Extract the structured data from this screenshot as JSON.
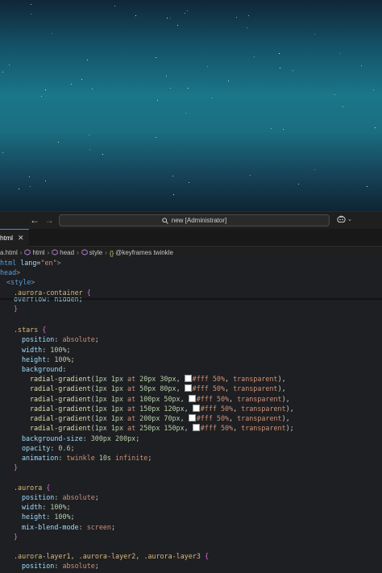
{
  "titlebar": {
    "search_text": "new [Administrator]"
  },
  "tab": {
    "label": "html",
    "close": "✕"
  },
  "breadcrumb": {
    "items": [
      "a.html",
      "html",
      "head",
      "style",
      "@keyframes twinkle"
    ]
  },
  "editor": {
    "lines": [
      {
        "kind": "html-open",
        "tag": "html",
        "attr": "lang",
        "val": "\"en\""
      },
      {
        "kind": "html-tag",
        "tag": "head"
      },
      {
        "kind": "html-tag",
        "tag": "style"
      },
      {
        "kind": "selector-open",
        "text": ".aurora-container"
      },
      {
        "kind": "partial",
        "text": "overflow: hidden;"
      },
      {
        "kind": "close"
      },
      {
        "kind": "blank"
      },
      {
        "kind": "selector-open",
        "text": ".stars"
      },
      {
        "kind": "decl",
        "prop": "position",
        "val": "absolute"
      },
      {
        "kind": "decl",
        "prop": "width",
        "val": "100%"
      },
      {
        "kind": "decl",
        "prop": "height",
        "val": "100%"
      },
      {
        "kind": "prop-only",
        "prop": "background"
      },
      {
        "kind": "grad",
        "size": "1px 1px",
        "pos": "20px 30px",
        "color": "#fff 50%",
        "end": "transparent",
        "sep": ","
      },
      {
        "kind": "grad",
        "size": "1px 1px",
        "pos": "50px 80px",
        "color": "#fff 50%",
        "end": "transparent",
        "sep": ","
      },
      {
        "kind": "grad",
        "size": "1px 1px",
        "pos": "100px 50px",
        "color": "#fff 50%",
        "end": "transparent",
        "sep": ","
      },
      {
        "kind": "grad",
        "size": "1px 1px",
        "pos": "150px 120px",
        "color": "#fff 50%",
        "end": "transparent",
        "sep": ","
      },
      {
        "kind": "grad",
        "size": "1px 1px",
        "pos": "200px 70px",
        "color": "#fff 50%",
        "end": "transparent",
        "sep": ","
      },
      {
        "kind": "grad",
        "size": "1px 1px",
        "pos": "250px 150px",
        "color": "#fff 50%",
        "end": "transparent",
        "sep": ";"
      },
      {
        "kind": "decl",
        "prop": "background-size",
        "val": "300px 200px"
      },
      {
        "kind": "decl",
        "prop": "opacity",
        "val": "0.6"
      },
      {
        "kind": "decl",
        "prop": "animation",
        "val": "twinkle 10s infinite"
      },
      {
        "kind": "close"
      },
      {
        "kind": "blank"
      },
      {
        "kind": "selector-open",
        "text": ".aurora"
      },
      {
        "kind": "decl",
        "prop": "position",
        "val": "absolute"
      },
      {
        "kind": "decl",
        "prop": "width",
        "val": "100%"
      },
      {
        "kind": "decl",
        "prop": "height",
        "val": "100%"
      },
      {
        "kind": "decl",
        "prop": "mix-blend-mode",
        "val": "screen"
      },
      {
        "kind": "close"
      },
      {
        "kind": "blank"
      },
      {
        "kind": "selector-open",
        "text": ".aurora-layer1, .aurora-layer2, .aurora-layer3"
      },
      {
        "kind": "decl",
        "prop": "position",
        "val": "absolute"
      }
    ]
  },
  "colors": {
    "accent": "#3b8eea",
    "editor_bg": "#1e1f22"
  }
}
